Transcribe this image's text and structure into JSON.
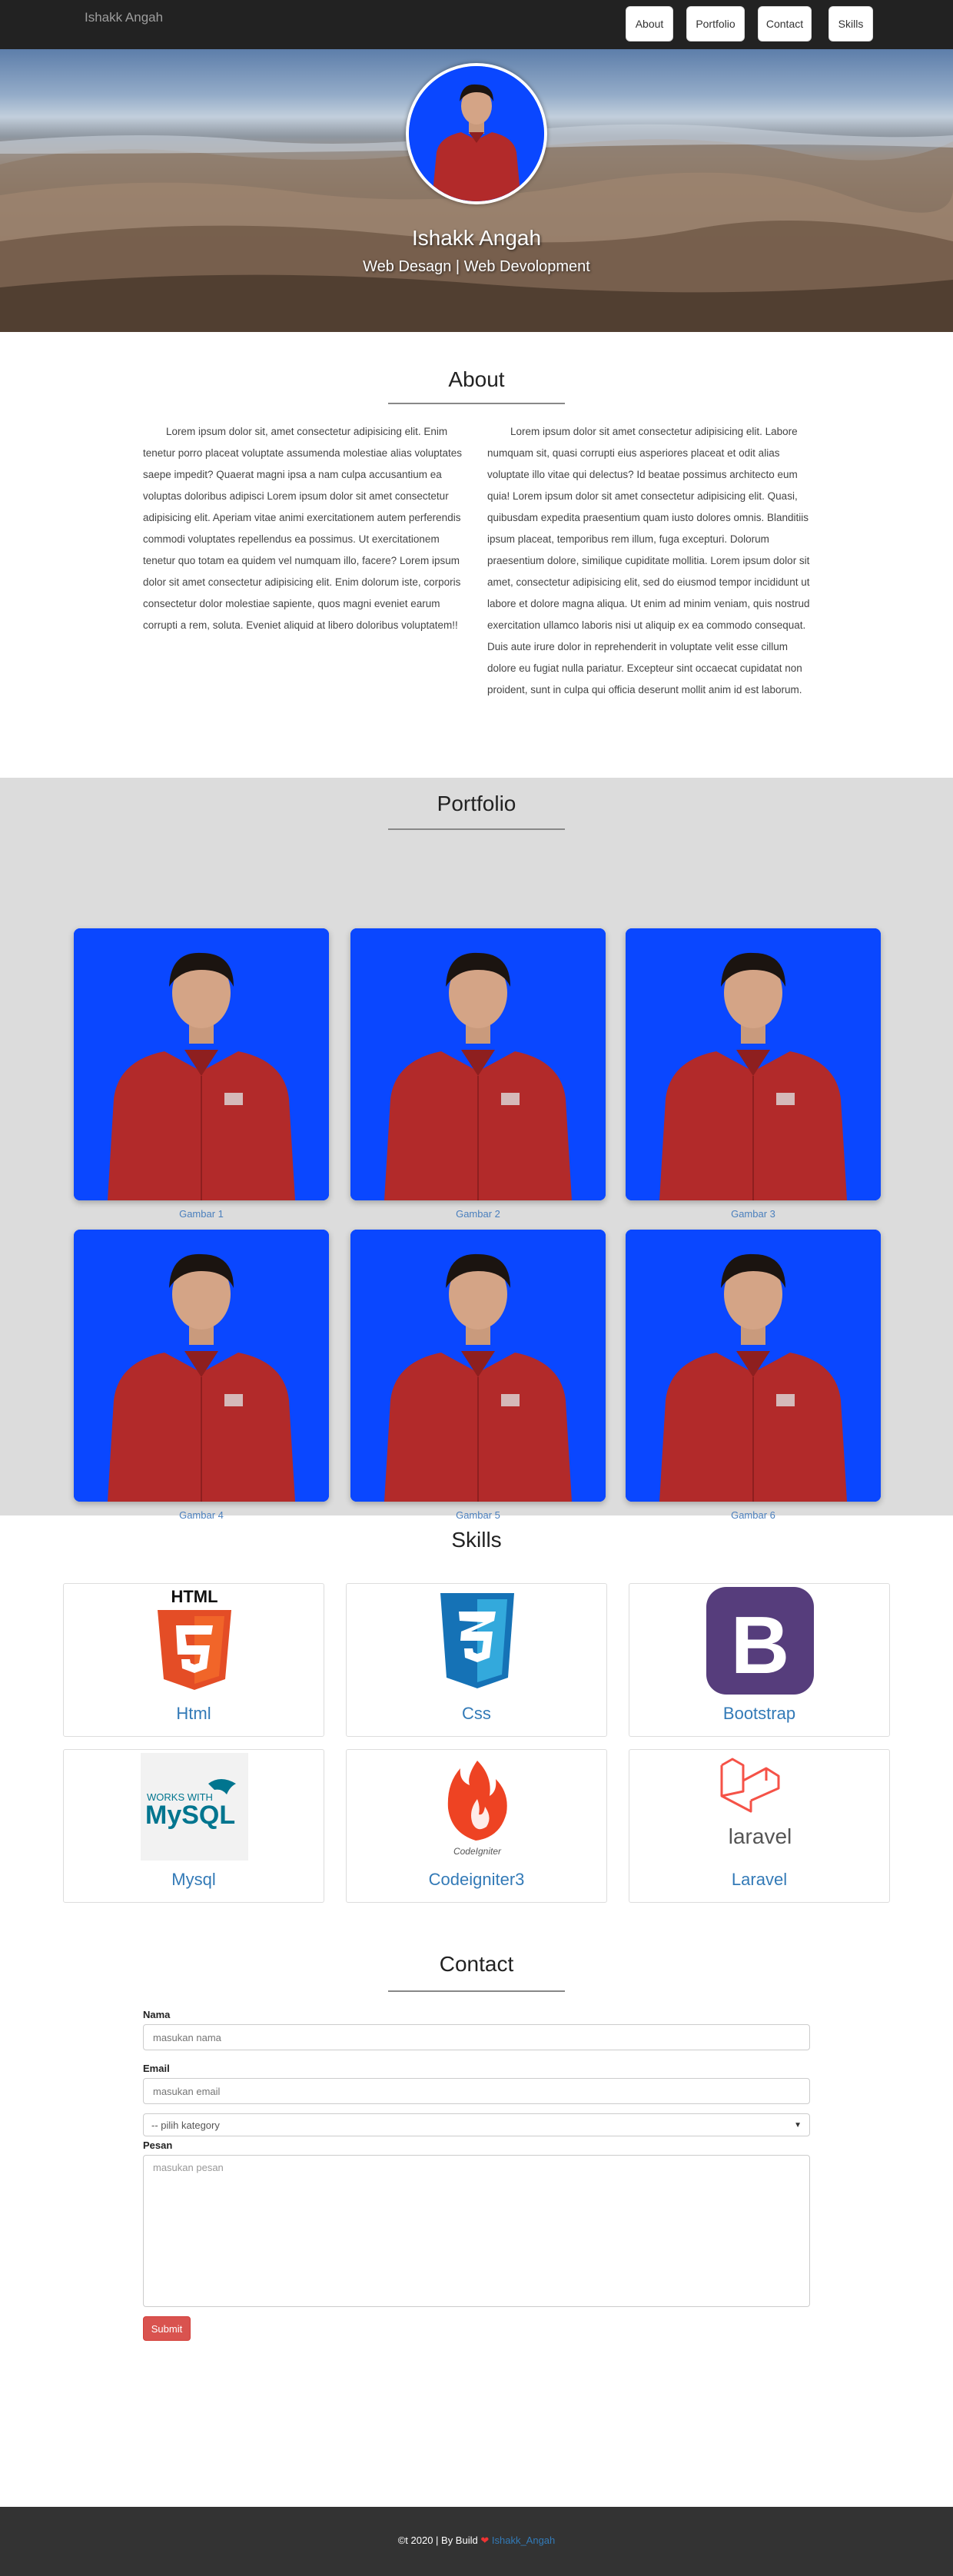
{
  "navbar": {
    "brand": "Ishakk Angah",
    "links": [
      "About",
      "Portfolio",
      "Contact",
      "Skills"
    ]
  },
  "hero": {
    "name": "Ishakk Angah",
    "subtitle": "Web Desagn | Web Devolopment"
  },
  "about": {
    "title": "About",
    "left": "Lorem ipsum dolor sit, amet consectetur adipisicing elit. Enim tenetur porro placeat voluptate assumenda molestiae alias voluptates saepe impedit? Quaerat magni ipsa a nam culpa accusantium ea voluptas doloribus adipisci Lorem ipsum dolor sit amet consectetur adipisicing elit. Aperiam vitae animi exercitationem autem perferendis commodi voluptates repellendus ea possimus. Ut exercitationem tenetur quo totam ea quidem vel numquam illo, facere? Lorem ipsum dolor sit amet consectetur adipisicing elit. Enim dolorum iste, corporis consectetur dolor molestiae sapiente, quos magni eveniet earum corrupti a rem, soluta. Eveniet aliquid at libero doloribus voluptatem!!",
    "right": "Lorem ipsum dolor sit amet consectetur adipisicing elit. Labore numquam sit, quasi corrupti eius asperiores placeat et odit alias voluptate illo vitae qui delectus? Id beatae possimus architecto eum quia! Lorem ipsum dolor sit amet consectetur adipisicing elit. Quasi, quibusdam expedita praesentium quam iusto dolores omnis. Blanditiis ipsum placeat, temporibus rem illum, fuga excepturi. Dolorum praesentium dolore, similique cupiditate mollitia. Lorem ipsum dolor sit amet, consectetur adipisicing elit, sed do eiusmod tempor incididunt ut labore et dolore magna aliqua. Ut enim ad minim veniam, quis nostrud exercitation ullamco laboris nisi ut aliquip ex ea commodo consequat. Duis aute irure dolor in reprehenderit in voluptate velit esse cillum dolore eu fugiat nulla pariatur. Excepteur sint occaecat cupidatat non proident, sunt in culpa qui officia deserunt mollit anim id est laborum."
  },
  "portfolio": {
    "title": "Portfolio",
    "items": [
      {
        "caption": "Gambar 1"
      },
      {
        "caption": "Gambar 2"
      },
      {
        "caption": "Gambar 3"
      },
      {
        "caption": "Gambar 4"
      },
      {
        "caption": "Gambar 5"
      },
      {
        "caption": "Gambar 6"
      }
    ]
  },
  "skills": {
    "title": "Skills",
    "items": [
      {
        "name": "Html",
        "icon": "html5-icon",
        "logo_text": "HTML"
      },
      {
        "name": "Css",
        "icon": "css3-icon"
      },
      {
        "name": "Bootstrap",
        "icon": "bootstrap-icon",
        "logo_text": "B"
      },
      {
        "name": "Mysql",
        "icon": "mysql-icon",
        "logo_text": "MySQL"
      },
      {
        "name": "Codeigniter3",
        "icon": "codeigniter-icon",
        "logo_text": "CodeIgniter"
      },
      {
        "name": "Laravel",
        "icon": "laravel-icon",
        "logo_text": "laravel"
      }
    ]
  },
  "contact": {
    "title": "Contact",
    "name_label": "Nama",
    "name_placeholder": "masukan nama",
    "email_label": "Email",
    "email_placeholder": "masukan email",
    "category_selected": "-- pilih kategory",
    "message_label": "Pesan",
    "message_placeholder": "masukan pesan",
    "submit_label": "Submit"
  },
  "footer": {
    "text": "©t 2020 | By Build",
    "author": "Ishakk_Angah"
  },
  "colors": {
    "navbar": "#222222",
    "link": "#337ab7",
    "photo_bg": "#0a47ff",
    "shirt": "#b22a2a",
    "submit": "#d9534f",
    "footer": "#333333",
    "portfolio_bg": "#dcdcdc"
  }
}
